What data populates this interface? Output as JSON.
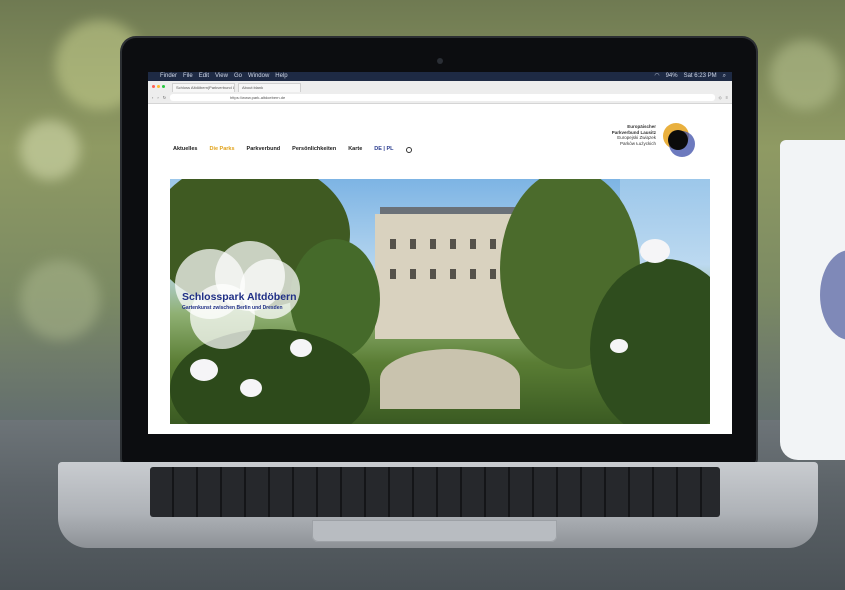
{
  "menubar": {
    "apple": "",
    "items": [
      "Finder",
      "File",
      "Edit",
      "View",
      "Go",
      "Window",
      "Help"
    ],
    "battery": "94%",
    "clock": "Sat 6:23 PM"
  },
  "browser": {
    "tabs": [
      "Schloss Altdöbern|Parkverbund Lausitz",
      "About:blank"
    ],
    "url": "https://www.park-altdoebern.de"
  },
  "site": {
    "nav": [
      "Aktuelles",
      "Die Parks",
      "Parkverbund",
      "Persönlichkeiten",
      "Karte"
    ],
    "active_nav": "Die Parks",
    "lang": "DE | PL",
    "logo_line1": "Europäischer",
    "logo_line2": "Parkverbund Lausitz",
    "logo_line3": "Europejski Związek",
    "logo_line4": "Parków Łużyckich"
  },
  "hero": {
    "title": "Schlosspark Altdöbern",
    "subtitle": "Gartenkunst zwischen Berlin und Dresden"
  },
  "colors": {
    "accent_gold": "#e1a21a",
    "brand_blue": "#1f2f86"
  }
}
